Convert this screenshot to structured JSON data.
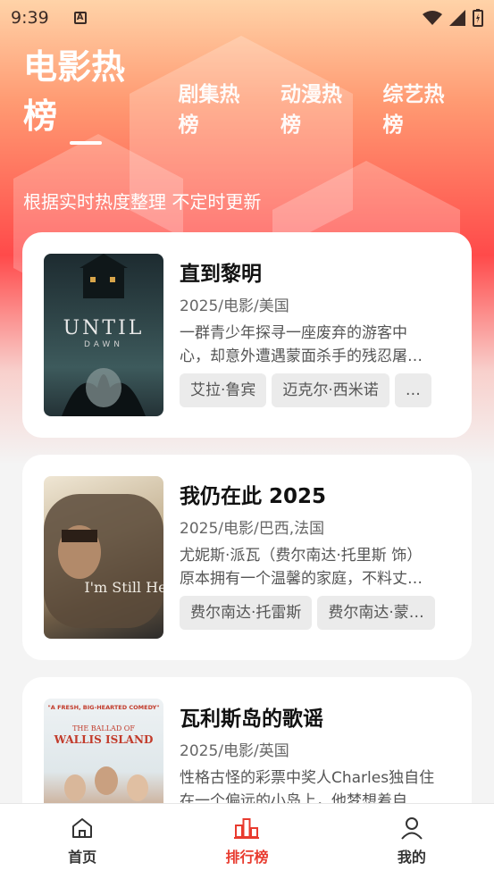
{
  "status_bar": {
    "time": "9:39"
  },
  "tabs": [
    {
      "label": "电影热榜",
      "active": true
    },
    {
      "label": "剧集热榜",
      "active": false
    },
    {
      "label": "动漫热榜",
      "active": false
    },
    {
      "label": "综艺热榜",
      "active": false
    }
  ],
  "subtitle": "根据实时热度整理 不定时更新",
  "movies": [
    {
      "title": "直到黎明",
      "meta": "2025/电影/美国",
      "desc_line1": "一群青少年探寻一座废弃的游客中",
      "desc_line2": "心，却意外遭遇蒙面杀手的残忍屠…",
      "chips": [
        "艾拉·鲁宾",
        "迈克尔·西米诺",
        "…"
      ],
      "poster_text": "UNTIL",
      "poster_sub": "DAWN"
    },
    {
      "title": "我仍在此 2025",
      "meta": "2025/电影/巴西,法国",
      "desc_line1": "尤妮斯·派瓦（费尔南达·托里斯 饰）",
      "desc_line2": "原本拥有一个温馨的家庭，不料丈…",
      "chips": [
        "费尔南达·托雷斯",
        "费尔南达·蒙…"
      ],
      "poster_text": "I'm Still Here"
    },
    {
      "title": "瓦利斯岛的歌谣",
      "meta": "2025/电影/英国",
      "desc_line1": "性格古怪的彩票中奖人Charles独自住",
      "desc_line2": "在一个偏远的小岛上，他梦想着自",
      "chips": [],
      "poster_text": "WALLIS ISLAND",
      "poster_top": "THE BALLAD OF",
      "poster_quote": "\"A FRESH, BIG-HEARTED COMEDY\""
    }
  ],
  "nav": [
    {
      "label": "首页",
      "icon": "home-icon",
      "active": false
    },
    {
      "label": "排行榜",
      "icon": "ranking-icon",
      "active": true
    },
    {
      "label": "我的",
      "icon": "profile-icon",
      "active": false
    }
  ],
  "colors": {
    "accent": "#e83a2e"
  }
}
